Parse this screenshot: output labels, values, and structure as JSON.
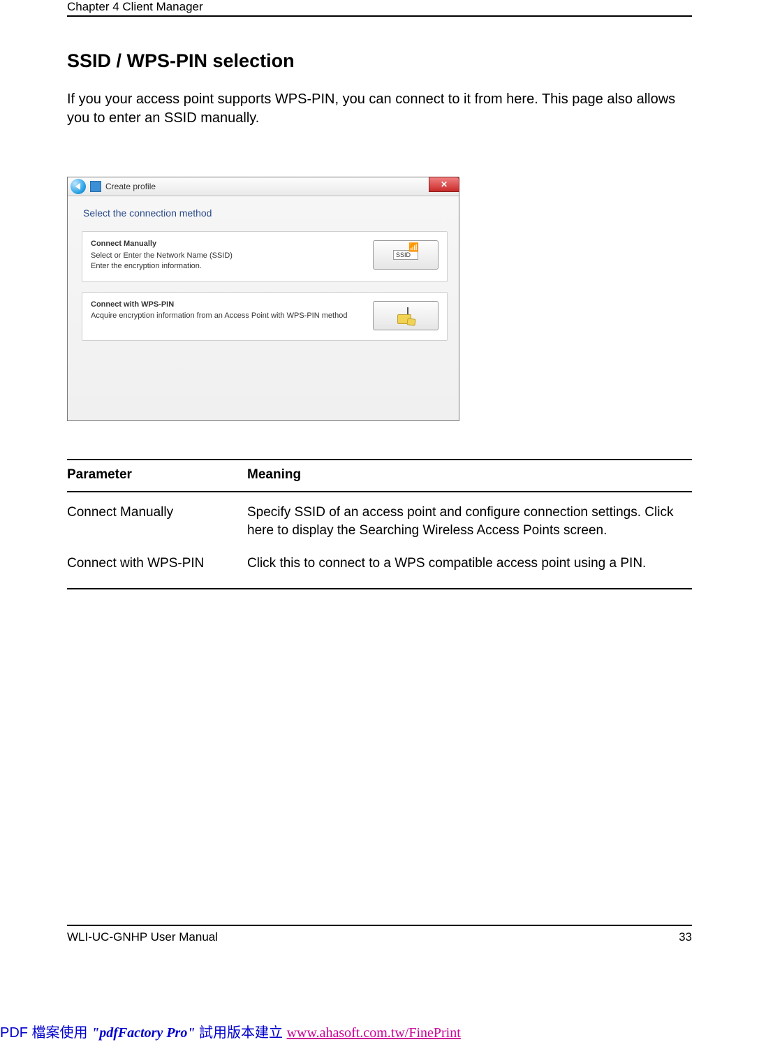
{
  "header": {
    "chapter": "Chapter 4  Client Manager"
  },
  "section": {
    "title": "SSID / WPS-PIN selection",
    "intro": "If you your access point supports WPS-PIN, you can connect to it from here.  This page also allows you to enter an SSID manually."
  },
  "screenshot": {
    "window_title": "Create profile",
    "prompt": "Select the connection method",
    "options": [
      {
        "title": "Connect Manually",
        "desc": "Select or Enter the Network Name (SSID)\nEnter the encryption information.",
        "button_text": "SSID"
      },
      {
        "title": "Connect with WPS-PIN",
        "desc": "Acquire encryption information from an Access Point with WPS-PIN method",
        "button_text": ""
      }
    ]
  },
  "table": {
    "head_param": "Parameter",
    "head_mean": "Meaning",
    "rows": [
      {
        "param": "Connect Manually",
        "mean": "Specify SSID of an access point and configure connection settings. Click here to display the Searching Wireless Access Points screen."
      },
      {
        "param": "Connect with WPS-PIN",
        "mean": "Click this to connect to a WPS compatible access point using a PIN."
      }
    ]
  },
  "footer": {
    "manual": "WLI-UC-GNHP User Manual",
    "page": "33"
  },
  "watermark": {
    "a": "PDF 檔案使用 ",
    "b": "\"pdfFactory Pro\"",
    "c": " 試用版本建立 ",
    "link": "www.ahasoft.com.tw/FinePrint"
  }
}
